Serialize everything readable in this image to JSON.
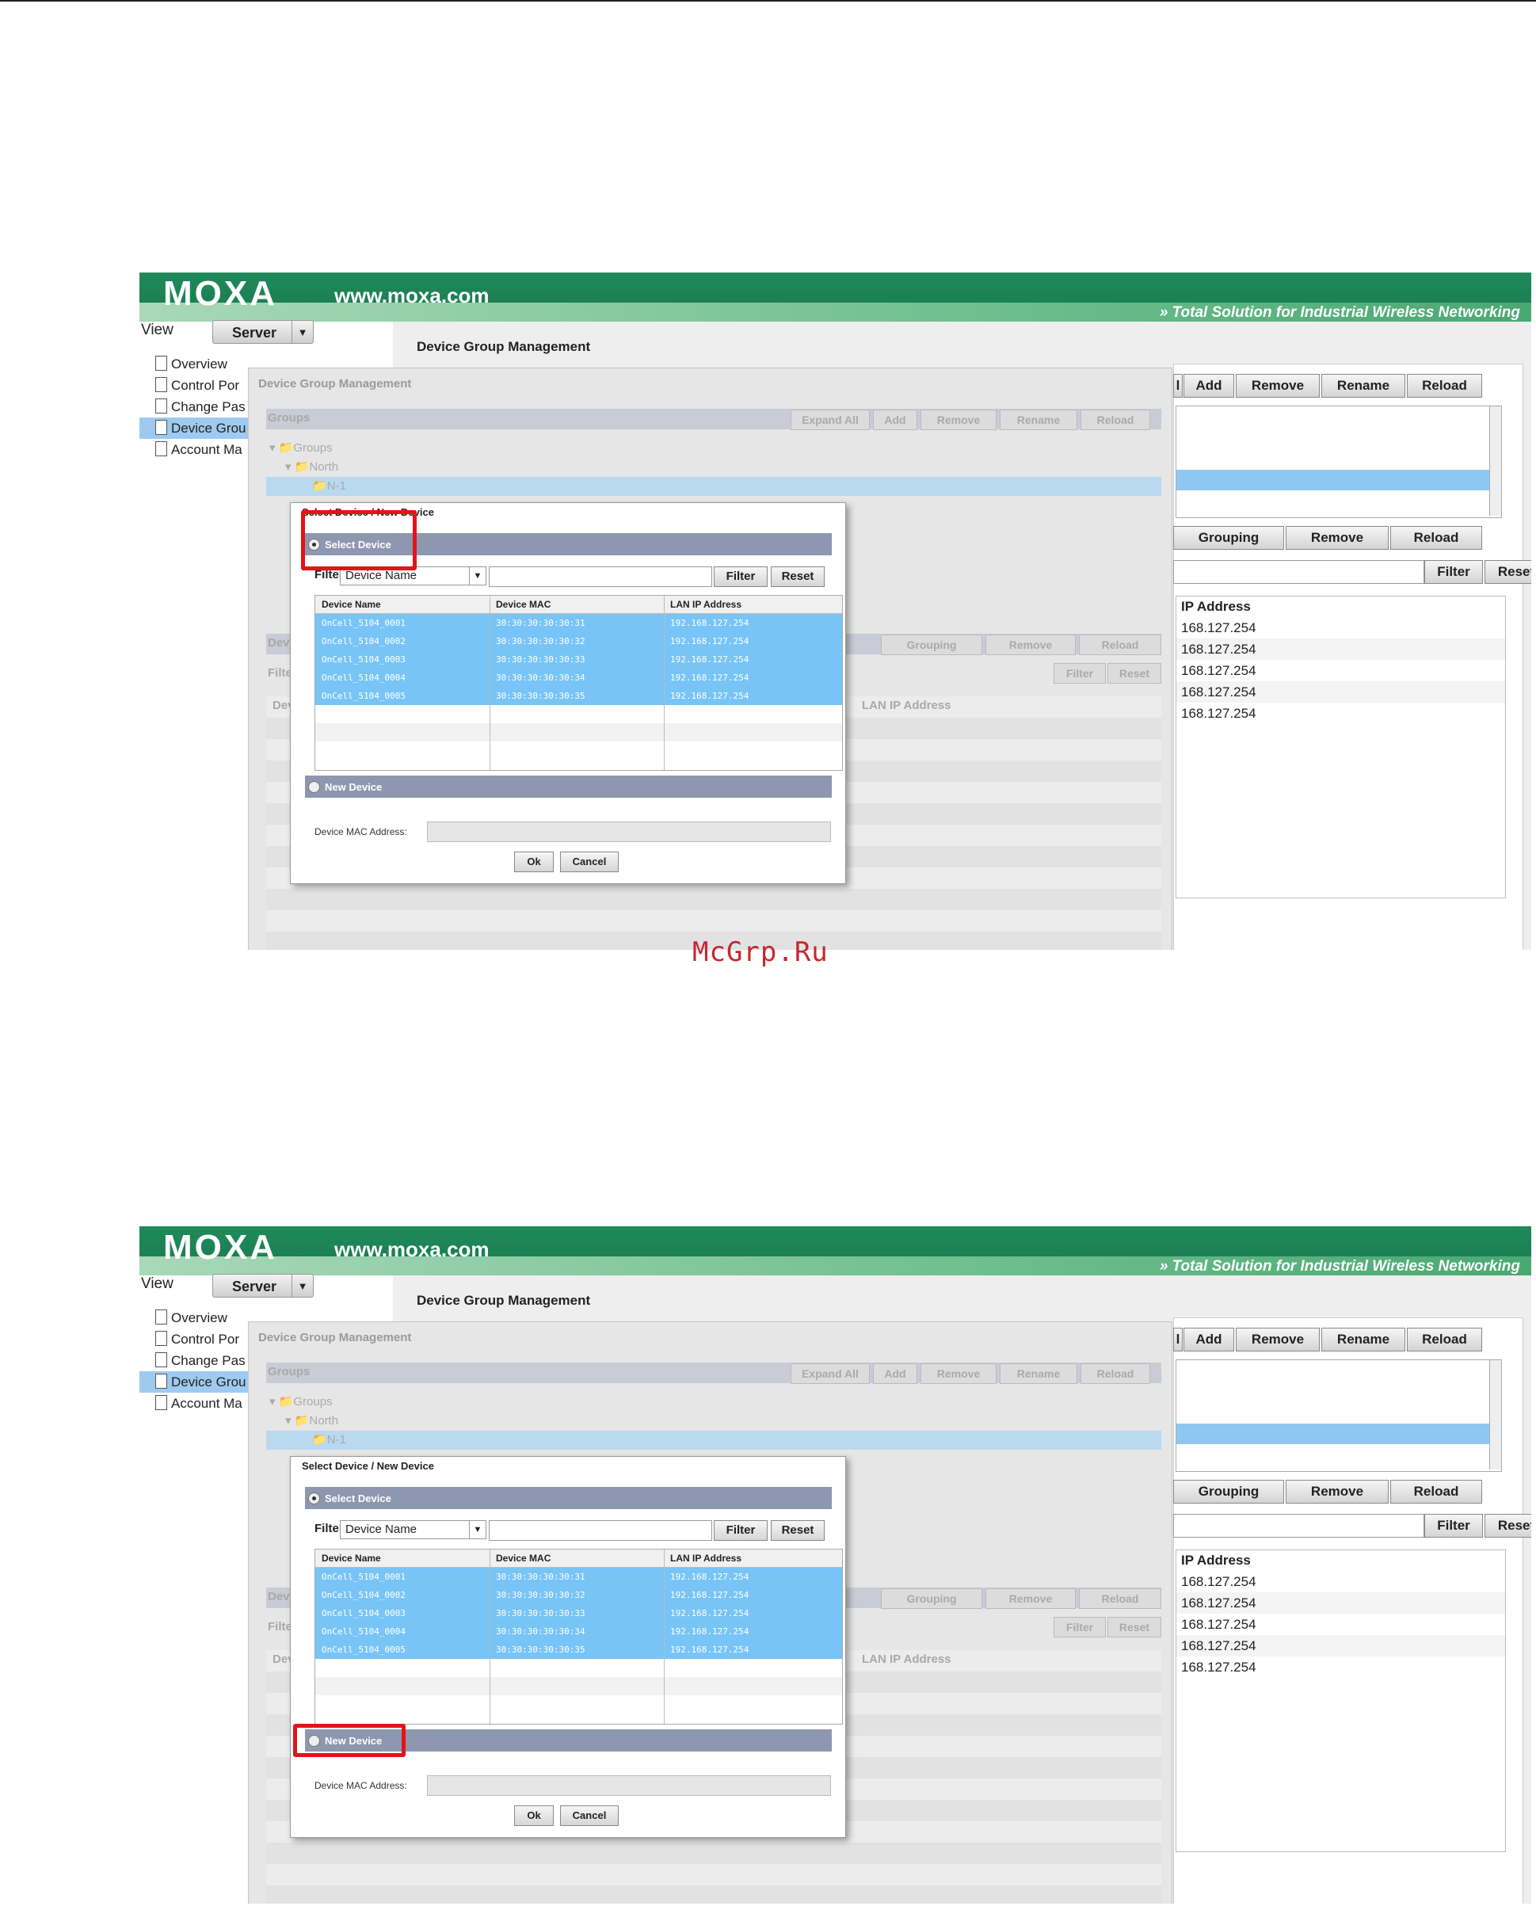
{
  "app": {
    "logo": "MOXA",
    "url": "www.moxa.com",
    "slogan": "» Total Solution for Industrial Wireless Networking",
    "view_label": "View",
    "view_select": "Server"
  },
  "sidebar": {
    "items": [
      {
        "label": "Overview"
      },
      {
        "label": "Control Por"
      },
      {
        "label": "Change Pas"
      },
      {
        "label": "Device Grou"
      },
      {
        "label": "Account Ma"
      }
    ]
  },
  "main": {
    "title": "Device Group Management",
    "group_toolbar": [
      "Add",
      "Remove",
      "Rename",
      "Reload"
    ],
    "device_toolbar": [
      "Grouping",
      "Remove",
      "Reload"
    ],
    "filter_buttons": [
      "Filter",
      "Reset"
    ],
    "column_ip": "IP Address",
    "ip_values": [
      "168.127.254",
      "168.127.254",
      "168.127.254",
      "168.127.254",
      "168.127.254"
    ]
  },
  "background_dialog": {
    "title": "Device Group Management",
    "groups_header": "Groups",
    "expand_all": "Expand All",
    "buttons": [
      "Add",
      "Remove",
      "Rename",
      "Reload"
    ],
    "tree": [
      "Groups",
      "North",
      "N-1"
    ],
    "device_buttons": [
      "Grouping",
      "Remove",
      "Reload"
    ],
    "filter_buttons": [
      "Filter",
      "Reset"
    ],
    "devices_header": "Devi",
    "filter_stub": "Filter",
    "col_stub": "Dev",
    "col_lan": "LAN IP Address"
  },
  "dialog": {
    "title": "Select Device / New Device",
    "select_device_label": "Select Device",
    "new_device_label": "New Device",
    "filter_label": "Filter:",
    "filter_field": "Device Name",
    "filter_button": "Filter",
    "reset_button": "Reset",
    "columns": [
      "Device Name",
      "Device MAC",
      "LAN IP Address"
    ],
    "rows": [
      {
        "name": "OnCell_5104_0001",
        "mac": "30:30:30:30:30:31",
        "ip": "192.168.127.254"
      },
      {
        "name": "OnCell_5104_0002",
        "mac": "30:30:30:30:30:32",
        "ip": "192.168.127.254"
      },
      {
        "name": "OnCell_5104_0003",
        "mac": "30:30:30:30:30:33",
        "ip": "192.168.127.254"
      },
      {
        "name": "OnCell_5104_0004",
        "mac": "30:30:30:30:30:34",
        "ip": "192.168.127.254"
      },
      {
        "name": "OnCell_5104_0005",
        "mac": "30:30:30:30:30:35",
        "ip": "192.168.127.254"
      }
    ],
    "mac_label": "Device MAC Address:",
    "mac_value": "",
    "ok_button": "Ok",
    "cancel_button": "Cancel"
  },
  "screenshots": [
    {
      "highlight": "select-device"
    },
    {
      "highlight": "new-device"
    }
  ],
  "watermark": "McGrp.Ru",
  "colors": {
    "brand_green": "#1f8a5a",
    "highlight_red": "#e41318",
    "selection_blue": "#78c4f6",
    "section_header": "#8e97b0"
  }
}
